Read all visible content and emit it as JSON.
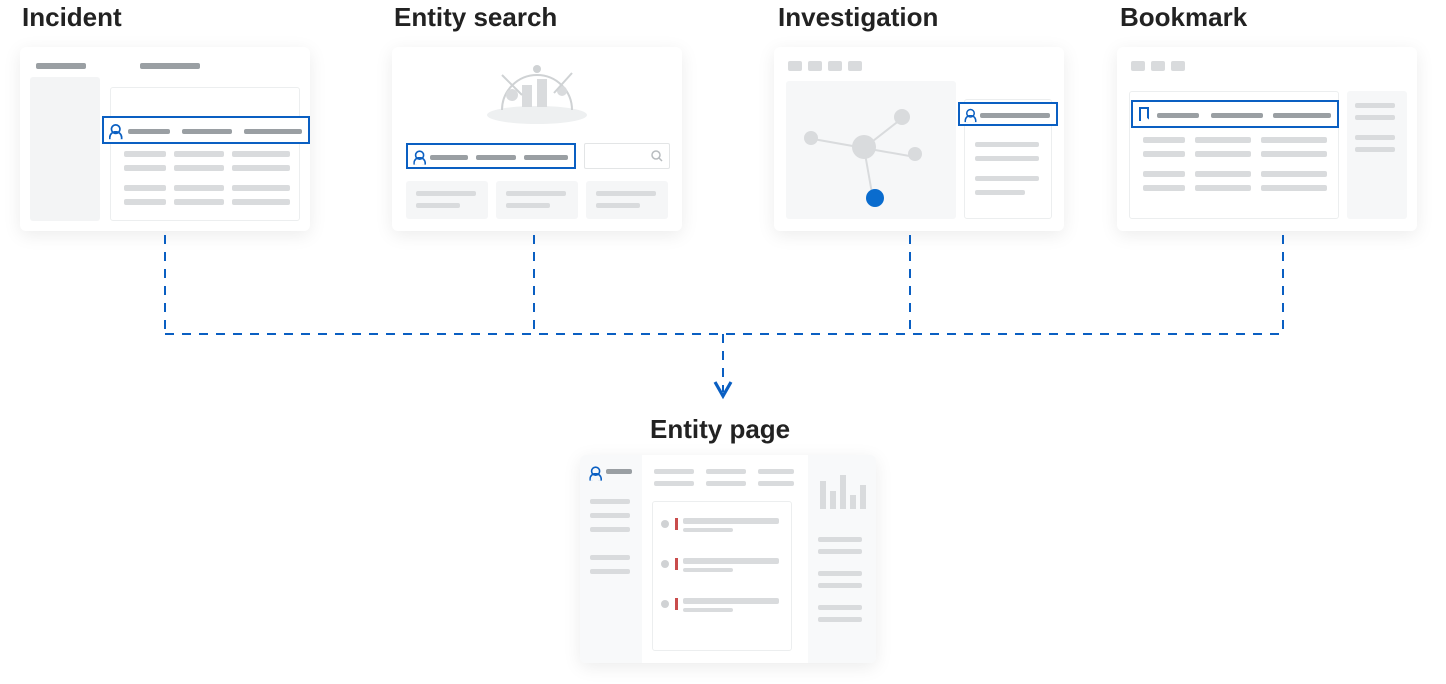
{
  "sources": [
    {
      "id": "incident",
      "label": "Incident"
    },
    {
      "id": "entity-search",
      "label": "Entity search"
    },
    {
      "id": "investigation",
      "label": "Investigation"
    },
    {
      "id": "bookmark",
      "label": "Bookmark"
    }
  ],
  "target": {
    "id": "entity-page",
    "label": "Entity page"
  },
  "colors": {
    "accent": "#0a5fc2",
    "placeholder_light": "#d9dbdd",
    "placeholder_dark": "#9a9fa3",
    "alert": "#c94d4d"
  }
}
